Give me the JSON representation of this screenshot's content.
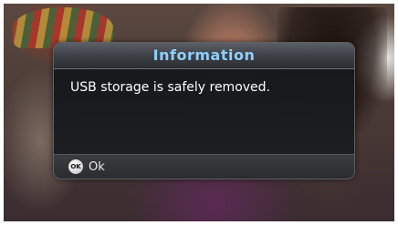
{
  "dialog": {
    "title": "Information",
    "message": "USB storage is safely removed.",
    "ok_icon_text": "OK",
    "ok_label": "Ok"
  },
  "colors": {
    "title_text": "#8ed0ff",
    "message_text": "#ffffff",
    "panel_bg": "#1c1e22"
  },
  "icons": {
    "ok": "ok-remote-button-icon"
  }
}
